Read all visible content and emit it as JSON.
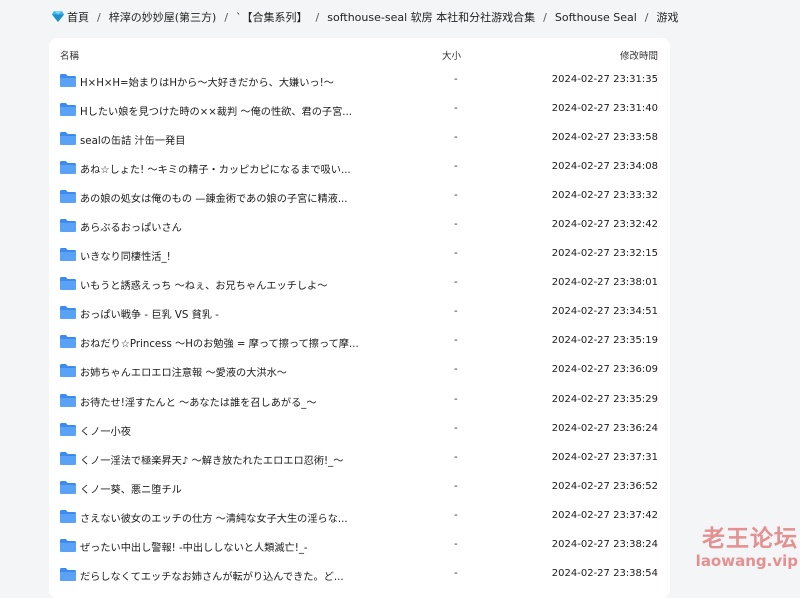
{
  "breadcrumb": {
    "home": "首頁",
    "items": [
      "梓滓の妙妙屋(第三方)",
      "`【合集系列】",
      "softhouse-seal 软房 本社和分社游戏合集",
      "Softhouse Seal",
      "游戏"
    ],
    "separator": "/"
  },
  "table": {
    "headers": {
      "name": "名稱",
      "size": "大小",
      "modified": "修改時間"
    },
    "rows": [
      {
        "name": "H×H×H=始まりはHから～大好きだから、大嫌いっ!～",
        "size": "-",
        "modified": "2024-02-27 23:31:35"
      },
      {
        "name": "Hしたい娘を見つけた時の××裁判 ～俺の性欲、君の子宮...",
        "size": "-",
        "modified": "2024-02-27 23:31:40"
      },
      {
        "name": "sealの缶詰 汁缶一発目",
        "size": "-",
        "modified": "2024-02-27 23:33:58"
      },
      {
        "name": "あね☆しょた! ～キミの精子・カッピカピになるまで吸い...",
        "size": "-",
        "modified": "2024-02-27 23:34:08"
      },
      {
        "name": "あの娘の処女は俺のもの —錬金術であの娘の子宮に精液...",
        "size": "-",
        "modified": "2024-02-27 23:33:32"
      },
      {
        "name": "あらぶるおっぱいさん",
        "size": "-",
        "modified": "2024-02-27 23:32:42"
      },
      {
        "name": "いきなり同棲性活_!",
        "size": "-",
        "modified": "2024-02-27 23:32:15"
      },
      {
        "name": "いもうと誘惑えっち ～ねぇ、お兄ちゃんエッチしよ～",
        "size": "-",
        "modified": "2024-02-27 23:38:01"
      },
      {
        "name": "おっぱい戦争 - 巨乳 VS 貧乳 -",
        "size": "-",
        "modified": "2024-02-27 23:34:51"
      },
      {
        "name": "おねだり☆Princess ～Hのお勉強 = 摩って擦って擦って摩...",
        "size": "-",
        "modified": "2024-02-27 23:35:19"
      },
      {
        "name": "お姉ちゃんエロエロ注意報 ～愛液の大洪水～",
        "size": "-",
        "modified": "2024-02-27 23:36:09"
      },
      {
        "name": "お待たせ!淫すたんと ～あなたは誰を召しあがる_～",
        "size": "-",
        "modified": "2024-02-27 23:35:29"
      },
      {
        "name": "くノ一小夜",
        "size": "-",
        "modified": "2024-02-27 23:36:24"
      },
      {
        "name": "くノ一淫法で極楽昇天♪ ～解き放たれたエロエロ忍術!_～",
        "size": "-",
        "modified": "2024-02-27 23:37:31"
      },
      {
        "name": "くノ一葵、悪ニ堕チル",
        "size": "-",
        "modified": "2024-02-27 23:36:52"
      },
      {
        "name": "さえない彼女のエッチの仕方 ～清純な女子大生の淫らな...",
        "size": "-",
        "modified": "2024-02-27 23:37:42"
      },
      {
        "name": "ぜったい中出し警報! -中出ししないと人類滅亡!_-",
        "size": "-",
        "modified": "2024-02-27 23:38:24"
      },
      {
        "name": "だらしなくてエッチなお姉さんが転がり込んできた。ど...",
        "size": "-",
        "modified": "2024-02-27 23:38:54"
      }
    ]
  },
  "watermark": {
    "text": "老王论坛",
    "url": "laowang.vip"
  },
  "colors": {
    "folder": "#3d8bf0",
    "panel": "#ffffff",
    "background": "#f4f5f7",
    "watermark": "#d73c3c"
  },
  "icons": {
    "home": "gem-icon",
    "folder": "folder-icon"
  }
}
